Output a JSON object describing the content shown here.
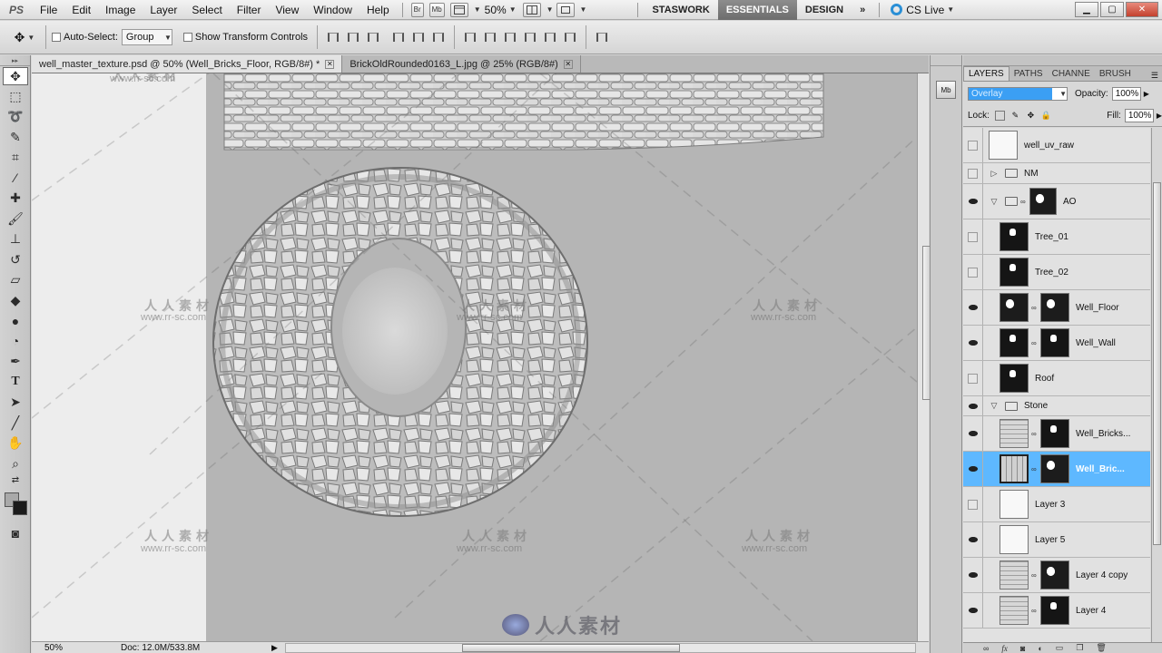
{
  "menubar": {
    "logo": "PS",
    "items": [
      "File",
      "Edit",
      "Image",
      "Layer",
      "Select",
      "Filter",
      "View",
      "Window",
      "Help"
    ],
    "br_label": "Br",
    "mb_label": "Mb",
    "zoom": "50%",
    "workspaces": [
      "STASWORK",
      "ESSENTIALS",
      "DESIGN"
    ],
    "more": "»",
    "cs_live": "CS Live"
  },
  "optionsbar": {
    "auto_select_label": "Auto-Select:",
    "auto_select_value": "Group",
    "show_transform_label": "Show Transform Controls"
  },
  "doc_tabs": [
    {
      "label": "well_master_texture.psd @ 50% (Well_Bricks_Floor, RGB/8#) *"
    },
    {
      "label": "BrickOldRounded0163_L.jpg @ 25% (RGB/8#)"
    }
  ],
  "status": {
    "zoom": "50%",
    "doc": "Doc: 12.0M/533.8M"
  },
  "layers_panel": {
    "tabs": [
      "LAYERS",
      "PATHS",
      "CHANNE",
      "BRUSH"
    ],
    "blend_mode": "Overlay",
    "opacity_label": "Opacity:",
    "opacity": "100%",
    "lock_label": "Lock:",
    "fill_label": "Fill:",
    "fill": "100%",
    "layers": [
      {
        "name": "well_uv_raw",
        "visible": false
      },
      {
        "name": "NM",
        "visible": false
      },
      {
        "name": "AO",
        "visible": true
      },
      {
        "name": "Tree_01",
        "visible": false
      },
      {
        "name": "Tree_02",
        "visible": false
      },
      {
        "name": "Well_Floor",
        "visible": true
      },
      {
        "name": "Well_Wall",
        "visible": true
      },
      {
        "name": "Roof",
        "visible": false
      },
      {
        "name": "Stone",
        "visible": true
      },
      {
        "name": "Well_Bricks...",
        "visible": true
      },
      {
        "name": "Well_Bric...",
        "visible": true,
        "selected": true
      },
      {
        "name": "Layer 3",
        "visible": false
      },
      {
        "name": "Layer 5",
        "visible": true
      },
      {
        "name": "Layer 4 copy",
        "visible": true
      },
      {
        "name": "Layer 4",
        "visible": true
      }
    ]
  },
  "watermark": {
    "text": "人人素材",
    "url": "www.rr-sc.com",
    "logo_text": "人人素材"
  },
  "colors": {
    "selection": "#5eb8ff",
    "blend_highlight": "#3b9ff4",
    "canvas_bg": "#b5b5b5"
  }
}
